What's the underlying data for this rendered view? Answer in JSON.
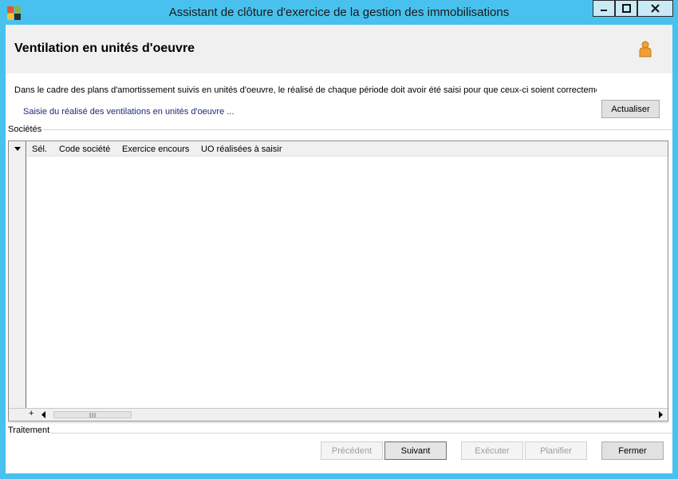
{
  "window": {
    "title": "Assistant de clôture d'exercice de la gestion des immobilisations",
    "controls": {
      "minimize": "▬",
      "maximize": "□",
      "close": "✕"
    }
  },
  "header": {
    "title": "Ventilation en unités d'oeuvre",
    "icon": "person-icon"
  },
  "description": "Dans le cadre des plans d'amortissement suivis en unités d'oeuvre, le réalisé de chaque période doit avoir été saisi pour que ceux-ci soient correctement év",
  "link": "Saisie du réalisé des ventilations en unités d'oeuvre ...",
  "refresh_button": "Actualiser",
  "companies_group": {
    "label": "Sociétés",
    "columns": [
      "Sél.",
      "Code société",
      "Exercice encours",
      "UO réalisées à saisir"
    ],
    "rows": []
  },
  "treatment_group": {
    "label": "Traitement"
  },
  "nav_buttons": {
    "previous": "Précédent",
    "next": "Suivant",
    "execute": "Exécuter",
    "schedule": "Planifier",
    "close": "Fermer"
  },
  "colors": {
    "titlebar": "#48c1ee",
    "link": "#1c2a78",
    "icon_orange": "#f0a030"
  }
}
